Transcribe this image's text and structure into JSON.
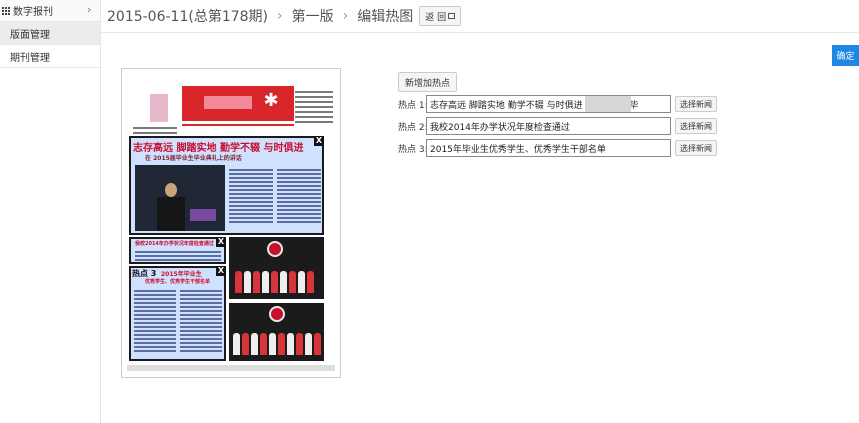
{
  "sidebar": {
    "header": "数字报刊",
    "items": [
      {
        "label": "版面管理",
        "active": true
      },
      {
        "label": "期刊管理",
        "active": false
      }
    ]
  },
  "header": {
    "crumbs": [
      "2015-06-11(总第178期)",
      "第一版",
      "编辑热图"
    ],
    "back_label": "返 回"
  },
  "confirm_label": "确定",
  "form": {
    "add_label": "新增加热点",
    "rows": [
      {
        "label": "热点 1:",
        "value": "志存高远 脚踏实地 勤学不辍 与时俱进 在     2015届毕",
        "button": "选择新闻"
      },
      {
        "label": "热点 2:",
        "value": "我校2014年办学状况年度检查通过",
        "button": "选择新闻"
      },
      {
        "label": "热点 3:",
        "value": "2015年毕业生优秀学生、优秀学生干部名单",
        "button": "选择新闻"
      }
    ]
  },
  "paper": {
    "hotspot1_title": "志存高远  脚踏实地  勤学不辍  与时俱进",
    "hotspot1_subtitle": "在      2015届毕业生毕业典礼上的讲话",
    "hotspot2_title": "我校2014年办学状况年度检查通过",
    "hotspot3_label": "热点 3",
    "hotspot3_title": "2015年毕业生",
    "hotspot3_subtitle": "优秀学生、优秀学生干部名单",
    "close_glyph": "X"
  },
  "colors": {
    "accent": "#1e88e5",
    "masthead": "#d8262b",
    "hotspot_overlay": "#78aaff"
  }
}
